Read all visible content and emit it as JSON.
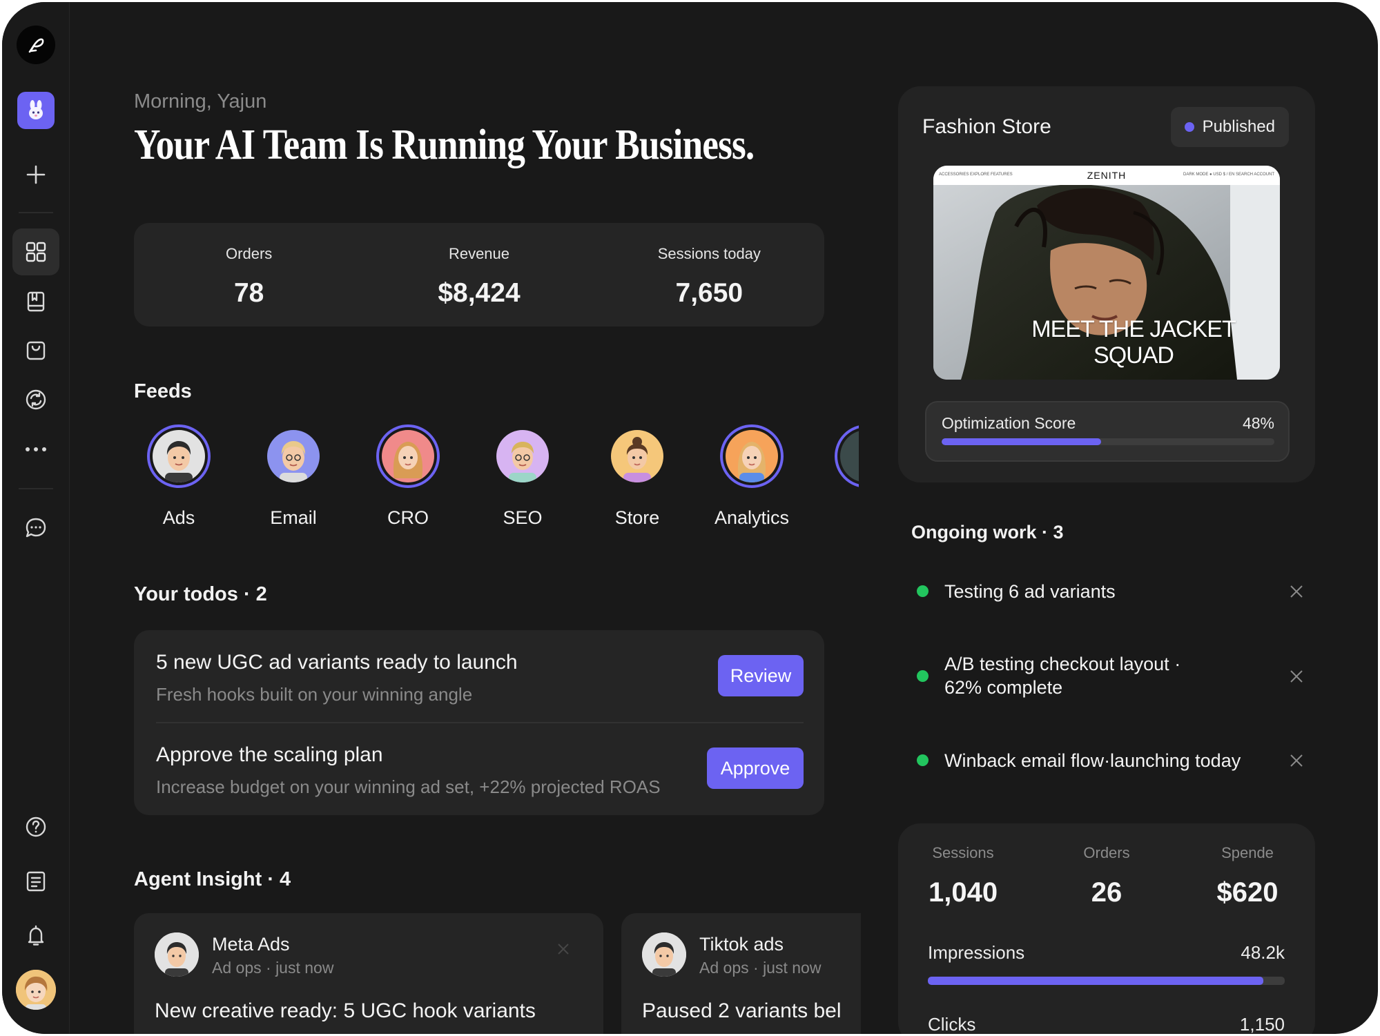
{
  "greeting": "Morning, Yajun",
  "headline": "Your AI Team Is Running Your Business.",
  "stats": [
    {
      "label": "Orders",
      "value": "78"
    },
    {
      "label": "Revenue",
      "value": "$8,424"
    },
    {
      "label": "Sessions today",
      "value": "7,650"
    }
  ],
  "feeds": {
    "title": "Feeds",
    "items": [
      {
        "label": "Ads",
        "active": true
      },
      {
        "label": "Email",
        "active": false
      },
      {
        "label": "CRO",
        "active": true
      },
      {
        "label": "SEO",
        "active": false
      },
      {
        "label": "Store",
        "active": false
      },
      {
        "label": "Analytics",
        "active": true
      }
    ]
  },
  "todos": {
    "title": "Your todos",
    "count": "2",
    "items": [
      {
        "title": "5 new UGC ad variants ready to launch",
        "subtitle": "Fresh hooks built on your winning angle",
        "button": "Review"
      },
      {
        "title": "Approve the scaling plan",
        "subtitle": "Increase budget on your winning ad set, +22% projected ROAS",
        "button": "Approve"
      }
    ]
  },
  "insights": {
    "title": "Agent Insight",
    "count": "4",
    "items": [
      {
        "name": "Meta Ads",
        "team": "Ad ops",
        "time": "just now",
        "text": "New creative ready: 5 UGC hook variants"
      },
      {
        "name": "Tiktok ads",
        "team": "Ad ops",
        "time": "just now",
        "text": "Paused 2 variants bel"
      }
    ]
  },
  "store": {
    "title": "Fashion Store",
    "status": "Published",
    "preview": {
      "brand": "ZENITH",
      "nav_left": "ACCESSORIES  EXPLORE  FEATURES",
      "nav_right": "DARK MODE ●  USD $ / EN  SEARCH  ACCOUNT",
      "hero_line1": "MEET THE JACKET",
      "hero_line2": "SQUAD"
    },
    "optimization": {
      "label": "Optimization Score",
      "value_text": "48%",
      "value": 0.48
    }
  },
  "ongoing": {
    "title": "Ongoing work",
    "count": "3",
    "items": [
      {
        "line1": "Testing 6 ad variants",
        "line2": ""
      },
      {
        "line1": "A/B testing checkout layout ·",
        "line2": "62% complete"
      },
      {
        "line1": "Winback email flow·launching today",
        "line2": ""
      }
    ]
  },
  "metrics": {
    "columns": [
      {
        "label": "Sessions",
        "value": "1,040"
      },
      {
        "label": "Orders",
        "value": "26"
      },
      {
        "label": "Spende",
        "value": "$620"
      }
    ],
    "impressions": {
      "label": "Impressions",
      "value_text": "48.2k",
      "value": 0.94
    },
    "clicks": {
      "label": "Clicks",
      "value_text": "1,150"
    }
  },
  "colors": {
    "accent": "#6c63f2",
    "success": "#22c55e",
    "background": "#191919",
    "card": "#252525"
  },
  "icons": [
    "app-logo-icon",
    "brand-rabbit-icon",
    "plus-icon",
    "dashboard-grid-icon",
    "book-icon",
    "shopping-bag-icon",
    "sync-icon",
    "more-icon",
    "chat-icon",
    "help-icon",
    "document-icon",
    "bell-icon",
    "close-icon"
  ]
}
